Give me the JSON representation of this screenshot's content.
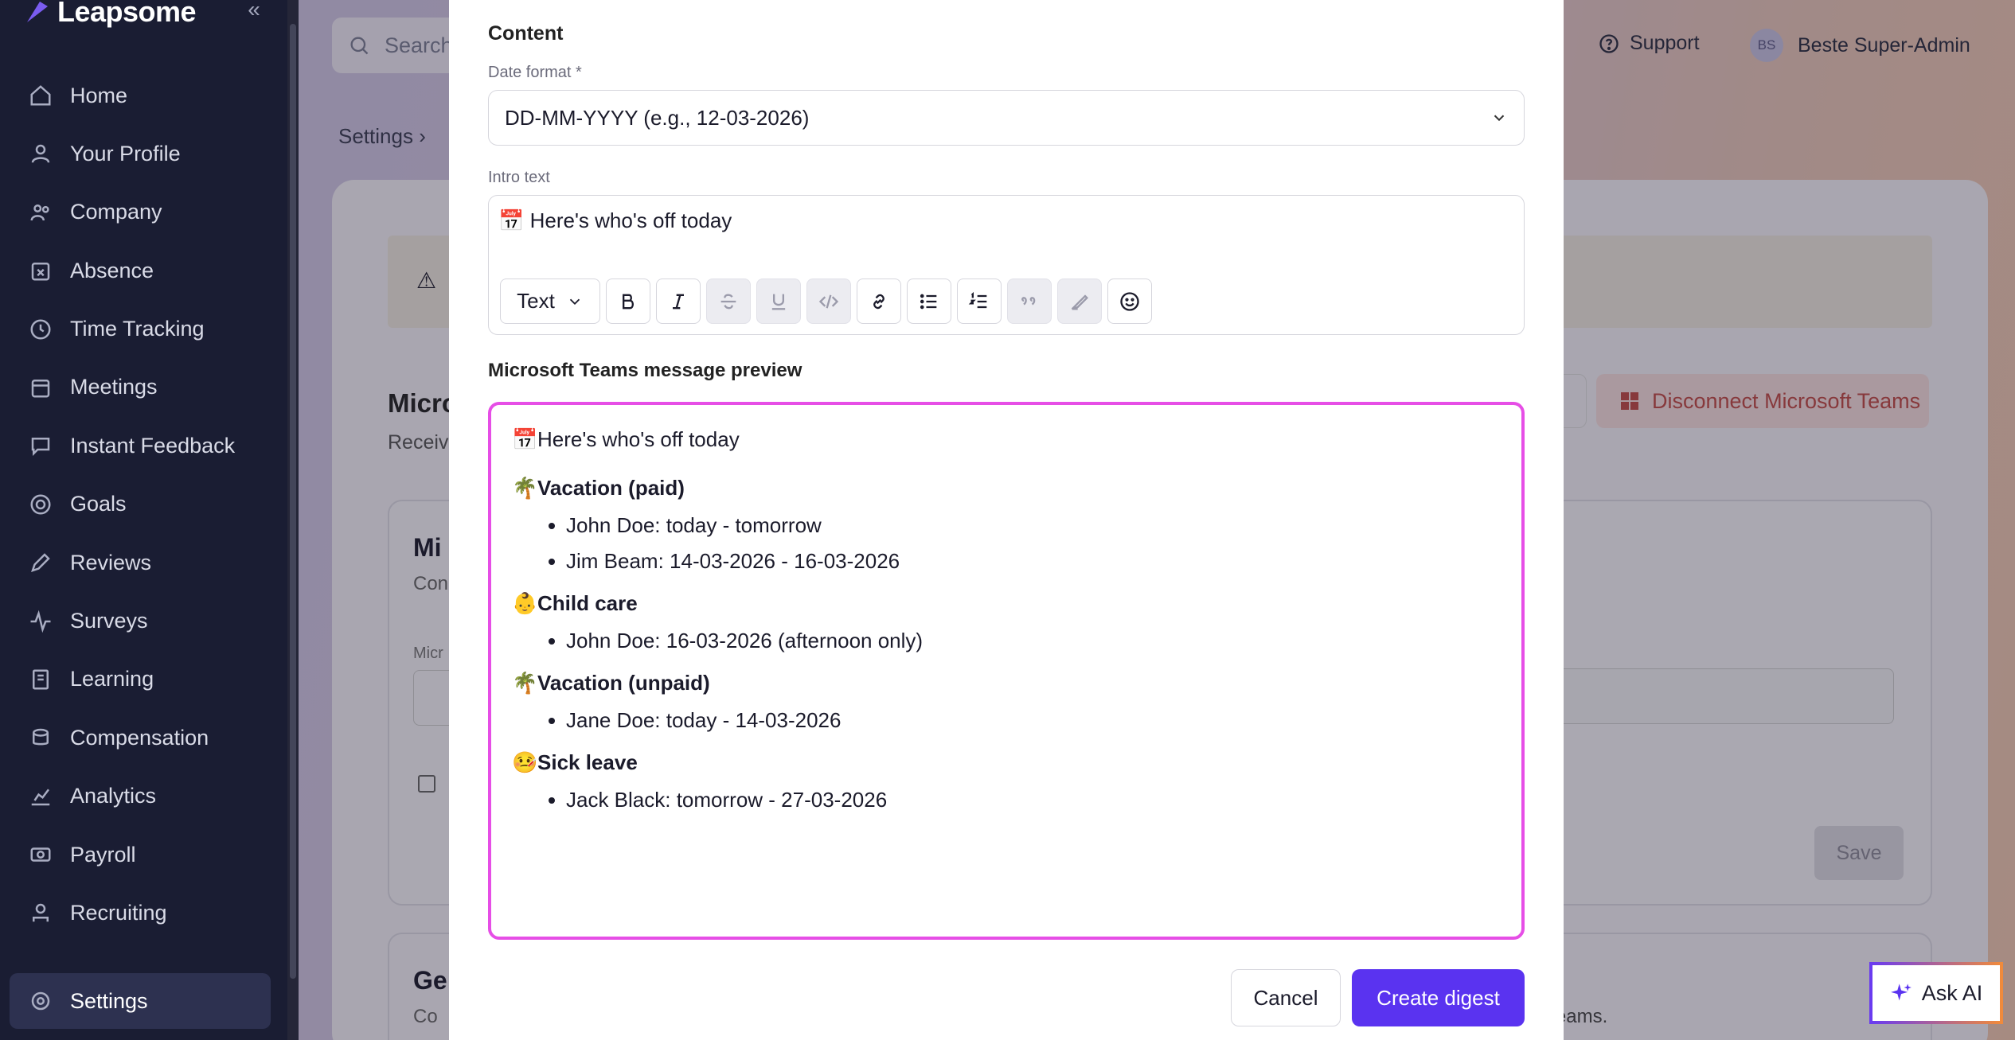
{
  "app": {
    "name": "Leapsome"
  },
  "sidebar": {
    "collapse_icon": "chevrons-left-icon",
    "items": [
      {
        "label": "Home",
        "icon": "home-icon"
      },
      {
        "label": "Your Profile",
        "icon": "user-icon"
      },
      {
        "label": "Company",
        "icon": "users-icon"
      },
      {
        "label": "Absence",
        "icon": "calendar-x-icon"
      },
      {
        "label": "Time Tracking",
        "icon": "clock-icon"
      },
      {
        "label": "Meetings",
        "icon": "calendar-icon"
      },
      {
        "label": "Instant Feedback",
        "icon": "chat-icon"
      },
      {
        "label": "Goals",
        "icon": "target-icon"
      },
      {
        "label": "Reviews",
        "icon": "pencil-icon"
      },
      {
        "label": "Surveys",
        "icon": "pulse-icon"
      },
      {
        "label": "Learning",
        "icon": "book-icon"
      },
      {
        "label": "Compensation",
        "icon": "coins-icon"
      },
      {
        "label": "Analytics",
        "icon": "chart-icon"
      },
      {
        "label": "Payroll",
        "icon": "banknote-icon"
      },
      {
        "label": "Recruiting",
        "icon": "person-badge-icon"
      }
    ],
    "active_item": {
      "label": "Settings",
      "icon": "gear-icon"
    }
  },
  "header": {
    "search_placeholder": "Search",
    "support_label": "Support",
    "user_initials": "BS",
    "user_name": "Beste Super-Admin"
  },
  "background": {
    "breadcrumb": "Settings",
    "section_title": "Micro",
    "section_sub": "Receiv",
    "disconnect_label": "Disconnect Microsoft Teams",
    "inner_title": "Mi",
    "inner_sub": "Con",
    "inner_label": "Micr",
    "save_label": "Save",
    "card2_title": "Ge",
    "card2_sub": "Co",
    "card2_right": "oft Teams."
  },
  "modal": {
    "section_title": "Content",
    "date_format_label": "Date format *",
    "date_format_value": "DD-MM-YYYY (e.g., 12-03-2026)",
    "intro_label": "Intro text",
    "intro_value": "📅 Here's who's off today",
    "toolbar": {
      "text_style": "Text",
      "buttons": [
        "bold-icon",
        "italic-icon",
        "strikethrough-icon",
        "underline-icon",
        "code-icon",
        "link-icon",
        "bullet-list-icon",
        "numbered-list-icon",
        "quote-icon",
        "highlighter-icon",
        "emoji-icon"
      ]
    },
    "preview_title": "Microsoft Teams message preview",
    "preview": {
      "intro": "Here's who's off today",
      "intro_emoji": "📅",
      "groups": [
        {
          "emoji": "🌴",
          "title": "Vacation (paid)",
          "items": [
            "John Doe: today - tomorrow",
            "Jim Beam: 14-03-2026 - 16-03-2026"
          ]
        },
        {
          "emoji": "👶",
          "title": "Child care",
          "items": [
            "John Doe: 16-03-2026 (afternoon only)"
          ]
        },
        {
          "emoji": "🌴",
          "title": "Vacation (unpaid)",
          "items": [
            "Jane Doe: today - 14-03-2026"
          ]
        },
        {
          "emoji": "🤒",
          "title": "Sick leave",
          "items": [
            "Jack Black: tomorrow - 27-03-2026"
          ]
        }
      ]
    },
    "cancel_label": "Cancel",
    "create_label": "Create digest"
  },
  "ask_ai": {
    "label": "Ask AI",
    "icon": "sparkle-icon"
  },
  "colors": {
    "accent": "#5a33f0",
    "preview_border": "#e64ee6",
    "sidebar_bg": "#1a1d33"
  }
}
